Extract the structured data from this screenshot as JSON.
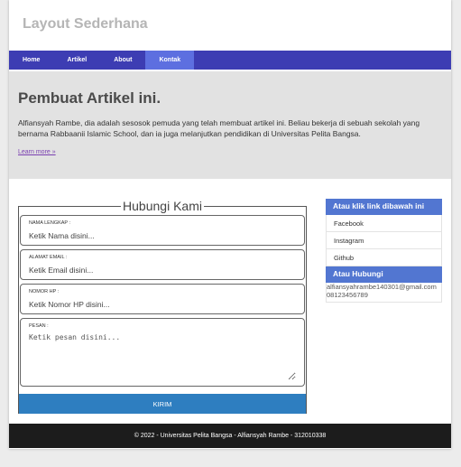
{
  "site": {
    "title": "Layout Sederhana"
  },
  "nav": {
    "items": [
      {
        "label": "Home"
      },
      {
        "label": "Artikel"
      },
      {
        "label": "About"
      },
      {
        "label": "Kontak"
      }
    ],
    "active": "Kontak"
  },
  "hero": {
    "title": "Pembuat Artikel ini.",
    "text": "Alfiansyah Rambe, dia adalah sesosok pemuda yang telah membuat artikel ini. Beliau bekerja di sebuah sekolah yang bernama Rabbaanii Islamic School, dan ia juga melanjutkan pendidikan di Universitas Pelita Bangsa.",
    "link": "Learn more »"
  },
  "form": {
    "legend": "Hubungi Kami",
    "name": {
      "label": "NAMA LENGKAP :",
      "placeholder": "Ketik Nama disini..."
    },
    "email": {
      "label": "ALAMAT EMAIL :",
      "placeholder": "Ketik Email disini..."
    },
    "phone": {
      "label": "NOMOR HP :",
      "placeholder": "Ketik Nomor HP disini..."
    },
    "message": {
      "label": "PESAN :",
      "placeholder": "Ketik pesan disini..."
    },
    "submit": "KIRIM"
  },
  "sidebar": {
    "links_heading": "Atau klik link dibawah ini",
    "links": [
      {
        "label": "Facebook"
      },
      {
        "label": "Instagram"
      },
      {
        "label": "Github"
      }
    ],
    "contact_heading": "Atau Hubungi",
    "email": "alfiansyahrambe140301@gmail.com",
    "phone": "08123456789"
  },
  "footer": {
    "text": "© 2022 - Universitas Pelita Bangsa - Alfiansyah Rambe - 312010338"
  },
  "colors": {
    "nav": "#3d3db3",
    "nav_active": "#5d6fe0",
    "hero_bg": "#e2e2e2",
    "button": "#2e7ec0",
    "sidebar_heading": "#5276d1",
    "footer": "#1c1c1c"
  }
}
